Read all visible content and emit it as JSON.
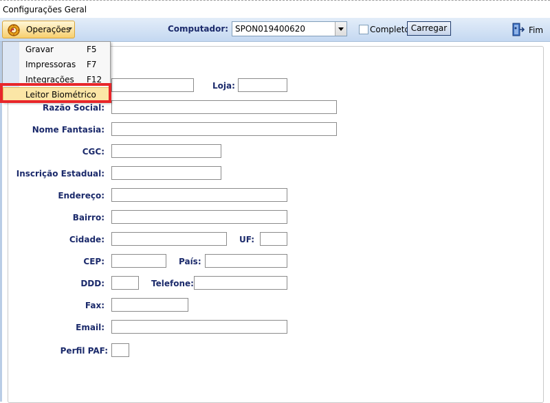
{
  "window": {
    "title": "Configurações Geral"
  },
  "toolbar": {
    "operations_label": "Operações",
    "computer_label": "Computador:",
    "computer_value": "SPON019400620",
    "complete_label": "Completo",
    "load_label": "Carregar",
    "exit_label": "Fim"
  },
  "menu": {
    "items": [
      {
        "label": "Gravar",
        "shortcut": "F5"
      },
      {
        "label": "Impressoras",
        "shortcut": "F7"
      },
      {
        "label": "Integrações",
        "shortcut": "F12"
      },
      {
        "label": "Leitor Biométrico",
        "shortcut": ""
      }
    ]
  },
  "form": {
    "loja_label": "Loja:",
    "razao_social_label": "Razão Social:",
    "nome_fantasia_label": "Nome Fantasia:",
    "cgc_label": "CGC:",
    "inscricao_estadual_label": "Inscrição Estadual:",
    "endereco_label": "Endereço:",
    "bairro_label": "Bairro:",
    "cidade_label": "Cidade:",
    "uf_label": "UF:",
    "cep_label": "CEP:",
    "pais_label": "País:",
    "ddd_label": "DDD:",
    "telefone_label": "Telefone:",
    "fax_label": "Fax:",
    "email_label": "Email:",
    "perfil_paf_label": "Perfil PAF:"
  },
  "colors": {
    "label_text": "#1b2a6b",
    "toolbar_bg": "#c4d8f1",
    "highlight": "#fbe6a6",
    "annotation_red": "#e8262a"
  }
}
